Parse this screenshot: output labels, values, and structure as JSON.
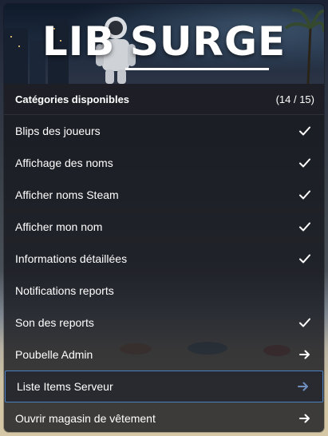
{
  "banner": {
    "title": "LIB SURGE"
  },
  "header": {
    "title": "Catégories disponibles",
    "counter": "(14 / 15)"
  },
  "items": [
    {
      "label": "Blips des joueurs",
      "icon": "check-icon",
      "selected": false
    },
    {
      "label": "Affichage des noms",
      "icon": "check-icon",
      "selected": false
    },
    {
      "label": "Afficher noms Steam",
      "icon": "check-icon",
      "selected": false
    },
    {
      "label": "Afficher mon nom",
      "icon": "check-icon",
      "selected": false
    },
    {
      "label": "Informations détaillées",
      "icon": "check-icon",
      "selected": false
    },
    {
      "label": "Notifications reports",
      "icon": "",
      "selected": false
    },
    {
      "label": "Son des reports",
      "icon": "check-icon",
      "selected": false
    },
    {
      "label": "Poubelle Admin",
      "icon": "arrow-right-icon",
      "selected": false
    },
    {
      "label": "Liste Items Serveur",
      "icon": "arrow-right-icon",
      "selected": true
    },
    {
      "label": "Ouvrir magasin de vêtement",
      "icon": "arrow-right-icon",
      "selected": false
    }
  ],
  "colors": {
    "selection_border": "#4a7fc2",
    "selected_arrow": "#6f8fbf",
    "text": "#ffffff",
    "panel": "#16181e"
  }
}
